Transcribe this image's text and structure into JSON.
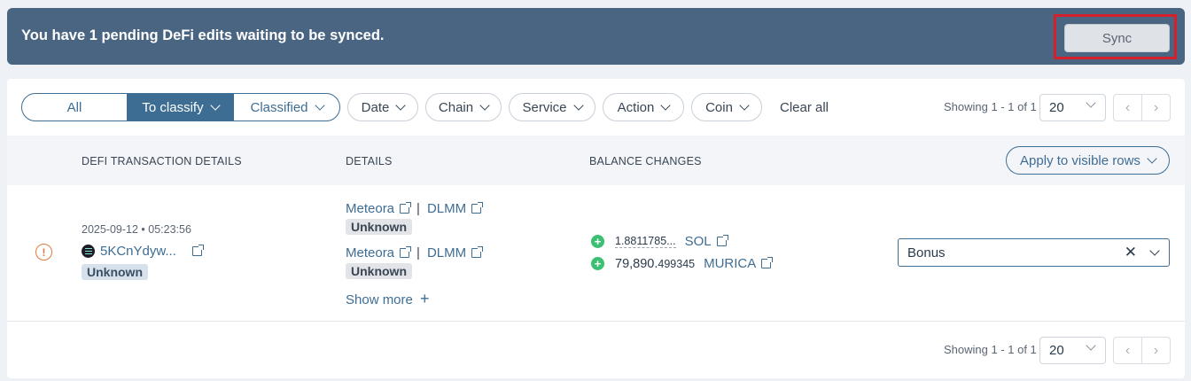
{
  "banner": {
    "message": "You have 1 pending DeFi edits waiting to be synced.",
    "sync_label": "Sync"
  },
  "filters": {
    "segments": [
      {
        "label": "All",
        "active": false
      },
      {
        "label": "To classify",
        "active": true
      },
      {
        "label": "Classified",
        "active": false
      }
    ],
    "pills": [
      "Date",
      "Chain",
      "Service",
      "Action",
      "Coin"
    ],
    "clear_all": "Clear all"
  },
  "pagination": {
    "showing": "Showing 1 - 1 of 1",
    "page_size": "20",
    "prev_icon": "chevron-left-icon",
    "next_icon": "chevron-right-icon"
  },
  "table": {
    "headers": {
      "tx": "DEFI TRANSACTION DETAILS",
      "details": "DETAILS",
      "balance": "BALANCE CHANGES"
    },
    "apply_label": "Apply to visible rows",
    "rows": [
      {
        "date": "2025-09-12 • 05:23:56",
        "hash": "5KCnYdyw...",
        "tag": "Unknown",
        "details": [
          {
            "service": "Meteora",
            "protocol": "DLMM",
            "tag": "Unknown"
          },
          {
            "service": "Meteora",
            "protocol": "DLMM",
            "tag": "Unknown"
          }
        ],
        "show_more": "Show more",
        "balances": [
          {
            "amount_main": "1.8811785...",
            "amount_sub": "",
            "coin": "SOL"
          },
          {
            "amount_main": "79,890.",
            "amount_sub": "499345",
            "coin": "MURICA"
          }
        ],
        "selected_type": "Bonus"
      }
    ]
  },
  "colors": {
    "banner_bg": "#4a6582",
    "accent": "#3e6d94",
    "highlight_border": "#d4202a",
    "positive": "#3bbf73",
    "warning": "#e07a3e"
  }
}
